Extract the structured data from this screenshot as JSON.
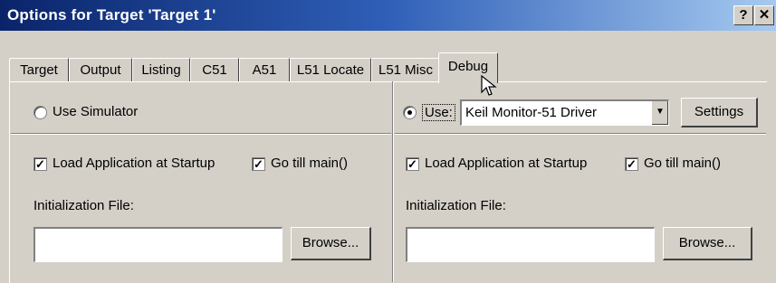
{
  "window": {
    "title": "Options for Target 'Target 1'",
    "help_button": "?",
    "close_button": "✕"
  },
  "tabs": [
    {
      "label": "Target"
    },
    {
      "label": "Output"
    },
    {
      "label": "Listing"
    },
    {
      "label": "C51"
    },
    {
      "label": "A51"
    },
    {
      "label": "L51 Locate"
    },
    {
      "label": "L51 Misc"
    },
    {
      "label": "Debug",
      "active": true
    }
  ],
  "simulator_side": {
    "use_simulator_label": "Use Simulator",
    "use_simulator_selected": false,
    "load_app_label": "Load Application at Startup",
    "load_app_checked": true,
    "go_till_main_label": "Go  till main()",
    "go_till_main_checked": true,
    "init_file_label": "Initialization File:",
    "init_file_value": "",
    "browse_label": "Browse..."
  },
  "target_side": {
    "use_label": "Use:",
    "use_selected": true,
    "driver_value": "Keil Monitor-51 Driver",
    "settings_label": "Settings",
    "load_app_label": "Load Application at Startup",
    "load_app_checked": true,
    "go_till_main_label": "Go  till main()",
    "go_till_main_checked": true,
    "init_file_label": "Initialization File:",
    "init_file_value": "",
    "browse_label": "Browse..."
  },
  "check_glyph": "✓"
}
